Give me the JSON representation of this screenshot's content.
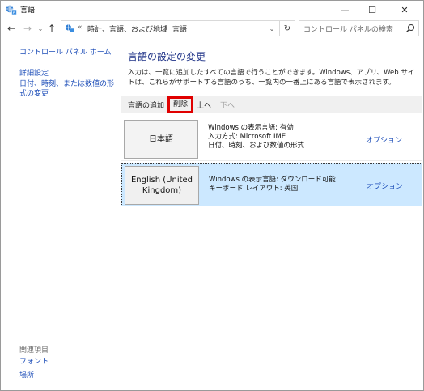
{
  "window": {
    "title": "言語"
  },
  "title_controls": {
    "minimize": "—",
    "maximize": "☐",
    "close": "✕"
  },
  "nav": {
    "back": "←",
    "forward": "→",
    "recent": "⌄",
    "up": "↑",
    "breadcrumb_prefix": "«",
    "breadcrumb": [
      "時計、言語、および地域",
      "言語"
    ],
    "breadcrumb_sep": "›",
    "dropdown": "⌄",
    "refresh": "↻",
    "search_placeholder": "コントロール パネルの検索"
  },
  "sidebar": {
    "home": "コントロール パネル ホーム",
    "advanced": "詳細設定",
    "date_format": "日付、時刻、または数値の形式の変更",
    "related_heading": "関連項目",
    "font": "フォント",
    "location": "場所"
  },
  "main": {
    "title": "言語の設定の変更",
    "description": "入力は、一覧に追加したすべての言語で行うことができます。Windows、アプリ、Web サイトは、これらがサポートする言語のうち、一覧内の一番上にある言語で表示されます。",
    "toolbar": {
      "add": "言語の追加",
      "remove": "削除",
      "up": "上へ",
      "down": "下へ"
    },
    "languages": [
      {
        "name": "日本語",
        "details": [
          "Windows の表示言語: 有効",
          "入力方式: Microsoft IME",
          "日付、時刻、および数値の形式"
        ],
        "options": "オプション"
      },
      {
        "name": "English (United Kingdom)",
        "details": [
          "Windows の表示言語: ダウンロード可能",
          "キーボード レイアウト: 英国"
        ],
        "options": "オプション"
      }
    ]
  },
  "colors": {
    "link": "#1c4db8",
    "title": "#1e3287",
    "selection": "#cce8ff",
    "highlight_box": "#e00000"
  }
}
